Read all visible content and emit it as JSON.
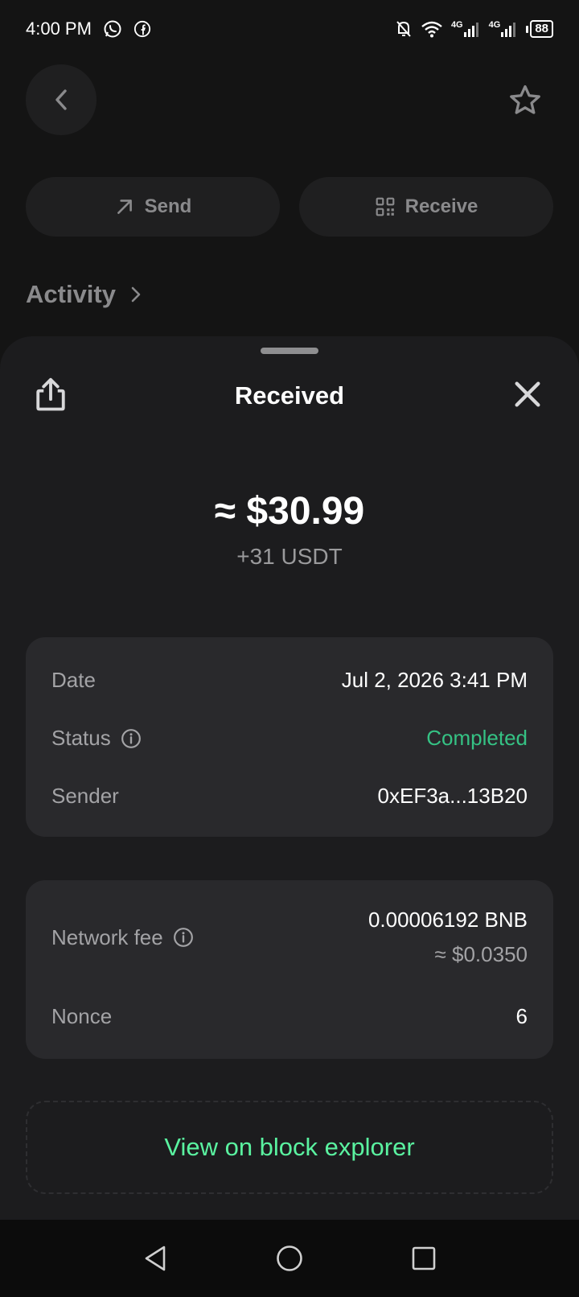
{
  "status_bar": {
    "time": "4:00 PM",
    "network_1": "4G",
    "network_2": "4G",
    "battery": "88"
  },
  "background": {
    "send_label": "Send",
    "receive_label": "Receive",
    "activity_label": "Activity"
  },
  "sheet": {
    "title": "Received",
    "amount_usd": "≈ $30.99",
    "amount_token": "+31 USDT",
    "details": {
      "date_label": "Date",
      "date_value": "Jul 2, 2026 3:41 PM",
      "status_label": "Status",
      "status_value": "Completed",
      "sender_label": "Sender",
      "sender_value": "0xEF3a...13B20"
    },
    "fees": {
      "fee_label": "Network fee",
      "fee_value": "0.00006192 BNB",
      "fee_usd": "≈ $0.0350",
      "nonce_label": "Nonce",
      "nonce_value": "6"
    },
    "explorer_label": "View on block explorer"
  },
  "colors": {
    "background": "#141414",
    "sheet": "#1c1c1e",
    "card": "#29292c",
    "status_green": "#35c284",
    "link_green": "#5af2a0"
  }
}
